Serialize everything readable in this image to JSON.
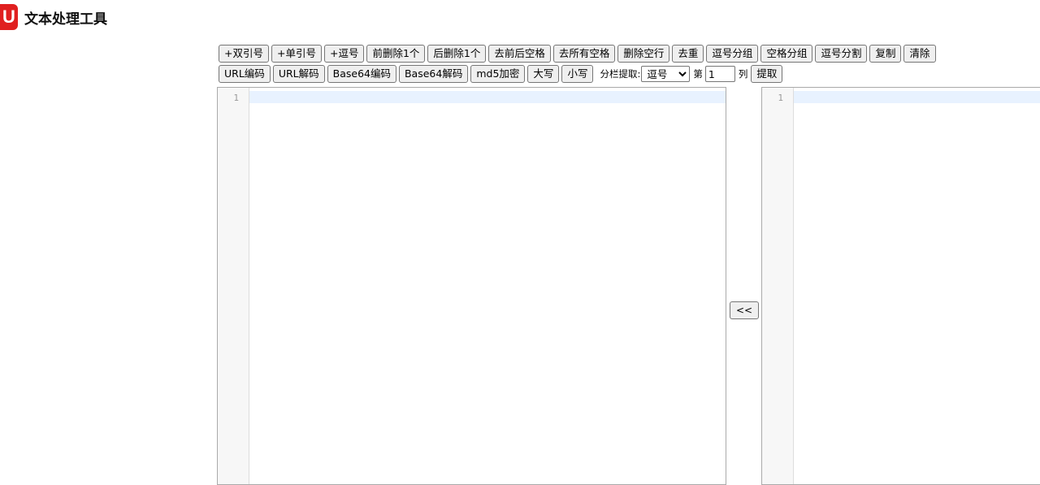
{
  "header": {
    "logo_letter": "U",
    "title": "文本处理工具"
  },
  "toolbar": {
    "row1": [
      "+双引号",
      "+单引号",
      "+逗号",
      "前删除1个",
      "后删除1个",
      "去前后空格",
      "去所有空格",
      "删除空行",
      "去重",
      "逗号分组",
      "空格分组",
      "逗号分割",
      "复制",
      "清除"
    ],
    "row2": [
      "URL编码",
      "URL解码",
      "Base64编码",
      "Base64解码",
      "md5加密",
      "大写",
      "小写"
    ],
    "split_label": "分栏提取:",
    "split_select": "逗号",
    "col_prefix": "第",
    "col_value": "1",
    "col_suffix": "列",
    "extract_button": "提取"
  },
  "editors": {
    "left": {
      "line_number": "1"
    },
    "right": {
      "line_number": "1"
    }
  },
  "transfer_button": "<<"
}
